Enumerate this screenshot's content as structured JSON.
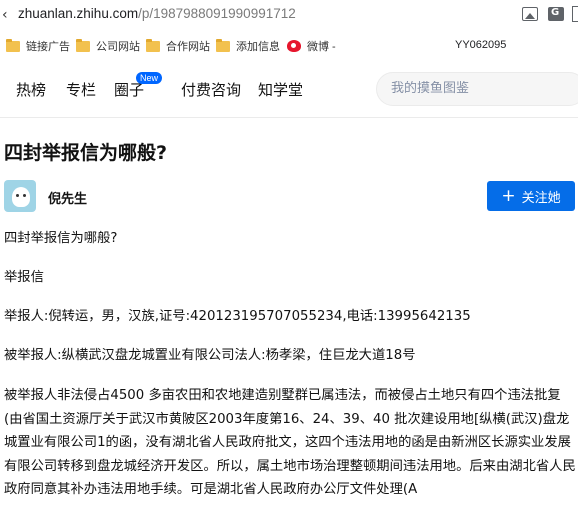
{
  "browser": {
    "url_host": "zhuanlan.zhihu.com",
    "url_path": "/p/1987988091990991712",
    "bookmarks": [
      {
        "label": "链接广告",
        "icon": "folder-icon"
      },
      {
        "label": "公司网站",
        "icon": "folder-icon"
      },
      {
        "label": "合作网站",
        "icon": "folder-icon"
      },
      {
        "label": "添加信息",
        "icon": "folder-icon"
      },
      {
        "label": "微博 -",
        "icon": "weibo-icon"
      }
    ],
    "bookmark_code": "YY062095"
  },
  "nav": {
    "items": [
      "热榜",
      "专栏",
      "圈子",
      "付费咨询",
      "知学堂"
    ],
    "new_badge": "New",
    "search_placeholder": "我的摸鱼图鉴"
  },
  "article": {
    "title": "四封举报信为哪般?",
    "author": "倪先生",
    "follow_label": "关注她",
    "paragraphs": [
      "四封举报信为哪般?",
      "举报信",
      "举报人:倪转运，男，汉族,证号:420123195707055234,电话:13995642135",
      "被举报人:纵横武汉盘龙城置业有限公司法人:杨孝梁，住巨龙大道18号",
      "被举报人非法侵占4500 多亩农田和农地建造别墅群已属违法，而被侵占土地只有四个违法批复(由省国土资源厅关于武汉市黄陂区2003年度第16、24、39、40 批次建设用地[纵横(武汉)盘龙城置业有限公司1的函，没有湖北省人民政府批文，这四个违法用地的函是由新洲区长源实业发展有限公司转移到盘龙城经济开发区。所以，属土地市场治理整顿期间违法用地。后来由湖北省人民政府同意其补办违法用地手续。可是湖北省人民政府办公厅文件处理(A"
    ]
  },
  "colors": {
    "accent": "#056de8",
    "badge": "#0066ff"
  }
}
